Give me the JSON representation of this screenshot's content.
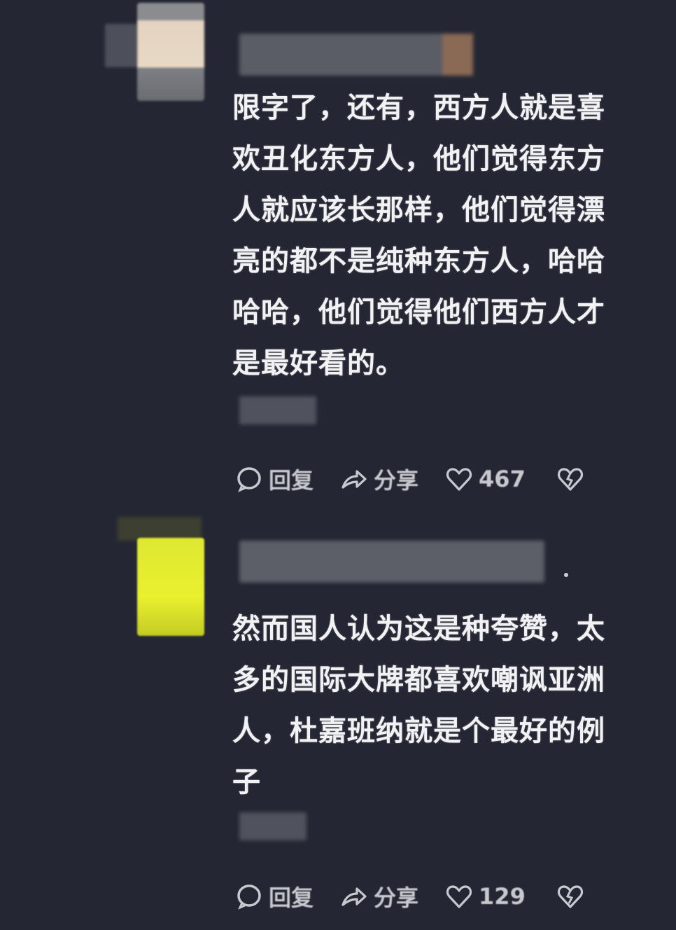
{
  "comments": [
    {
      "text": "限字了，还有，西方人就是喜\n欢丑化东方人，他们觉得东方\n人就应该长那样，他们觉得漂\n亮的都不是纯种东方人，哈哈\n哈哈，他们觉得他们西方人才\n是最好看的。",
      "actions": {
        "reply_label": "回复",
        "share_label": "分享",
        "like_count": "467"
      }
    },
    {
      "text": "然而国人认为这是种夸赞，太\n多的国际大牌都喜欢嘲讽亚洲\n人，杜嘉班纳就是个最好的例\n子",
      "actions": {
        "reply_label": "回复",
        "share_label": "分享",
        "like_count": "129"
      }
    }
  ],
  "icons": {
    "reply": "comment-bubble-icon",
    "share": "share-arrow-icon",
    "like": "heart-icon",
    "dislike": "broken-heart-icon"
  },
  "colors": {
    "background": "#242633",
    "text": "#f2f2f4",
    "action_text": "#c8c9ce"
  }
}
